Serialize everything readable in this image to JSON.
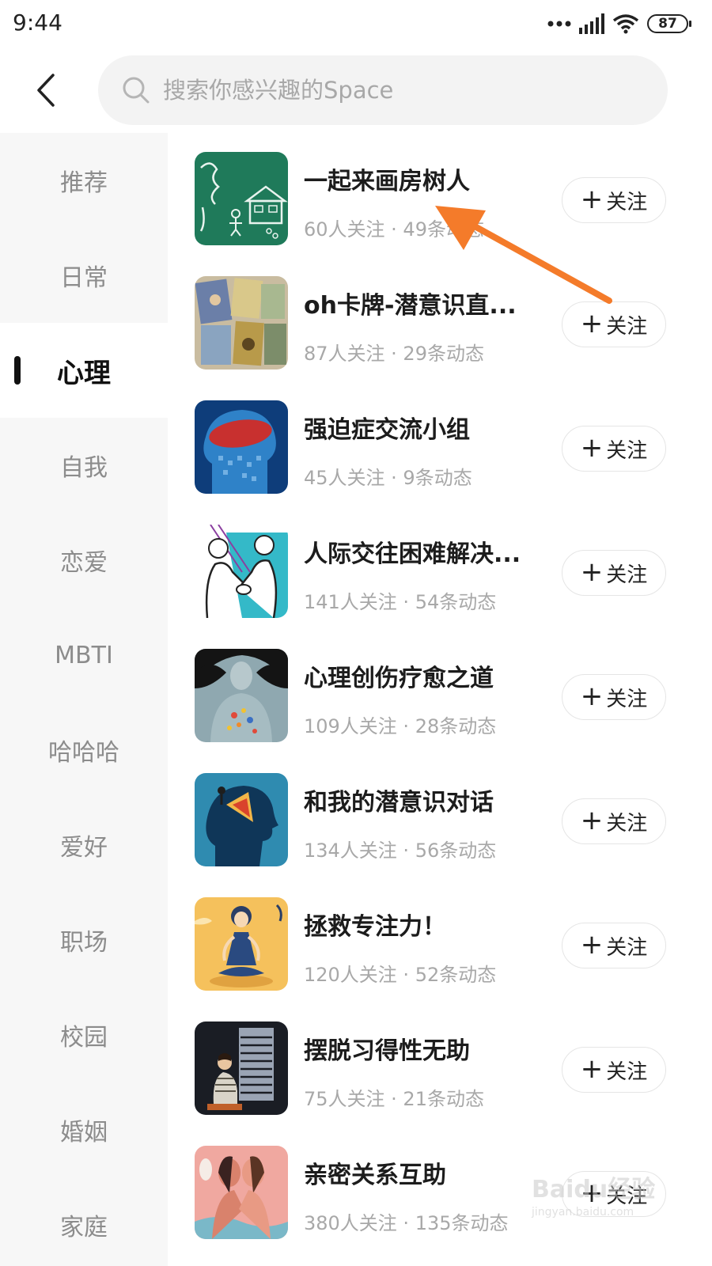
{
  "status_bar": {
    "time": "9:44",
    "battery": "87"
  },
  "search": {
    "placeholder": "搜索你感兴趣的Space",
    "value": ""
  },
  "sidebar": {
    "items": [
      {
        "label": "推荐",
        "active": false
      },
      {
        "label": "日常",
        "active": false
      },
      {
        "label": "心理",
        "active": true
      },
      {
        "label": "自我",
        "active": false
      },
      {
        "label": "恋爱",
        "active": false
      },
      {
        "label": "MBTI",
        "active": false
      },
      {
        "label": "哈哈哈",
        "active": false
      },
      {
        "label": "爱好",
        "active": false
      },
      {
        "label": "职场",
        "active": false
      },
      {
        "label": "校园",
        "active": false
      },
      {
        "label": "婚姻",
        "active": false
      },
      {
        "label": "家庭",
        "active": false
      }
    ]
  },
  "follow_label": "关注",
  "spaces": [
    {
      "name": "一起来画房树人",
      "stats": "60人关注 · 49条动态",
      "thumb": "house-tree-person-drawing"
    },
    {
      "name": "oh卡牌-潜意识直...",
      "stats": "87人关注 · 29条动态",
      "thumb": "oh-cards"
    },
    {
      "name": "强迫症交流小组",
      "stats": "45人关注 · 9条动态",
      "thumb": "ocd-head"
    },
    {
      "name": "人际交往困难解决...",
      "stats": "141人关注 · 54条动态",
      "thumb": "handshake-people"
    },
    {
      "name": "心理创伤疗愈之道",
      "stats": "109人关注 · 28条动态",
      "thumb": "healing-woman"
    },
    {
      "name": "和我的潜意识对话",
      "stats": "134人关注 · 56条动态",
      "thumb": "subconscious-head"
    },
    {
      "name": "拯救专注力！",
      "stats": "120人关注 · 52条动态",
      "thumb": "meditation-woman"
    },
    {
      "name": "摆脱习得性无助",
      "stats": "75人关注 · 21条动态",
      "thumb": "helpless-person"
    },
    {
      "name": "亲密关系互助",
      "stats": "380人关注 · 135条动态",
      "thumb": "intimate-couple"
    }
  ],
  "annotation": {
    "color": "#f47b2a"
  },
  "watermark": {
    "logo": "Baidu经验",
    "url": "jingyan.baidu.com"
  }
}
